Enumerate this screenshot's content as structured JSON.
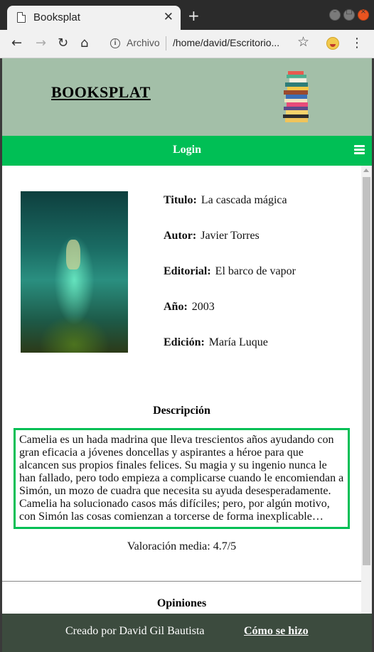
{
  "browser": {
    "tab_title": "Booksplat",
    "tab_close": "✕",
    "new_tab": "+",
    "url_secure_label": "Archivo",
    "url": "/home/david/Escritorio..."
  },
  "header": {
    "site_title": "BOOKSPLAT"
  },
  "navbar": {
    "login_label": "Login"
  },
  "book": {
    "fields": [
      {
        "label": "Titulo:",
        "value": "La cascada mágica"
      },
      {
        "label": "Autor:",
        "value": "Javier Torres"
      },
      {
        "label": "Editorial:",
        "value": "El barco de vapor"
      },
      {
        "label": "Año:",
        "value": "2003"
      },
      {
        "label": "Edición:",
        "value": "María Luque"
      }
    ],
    "description_title": "Descripción",
    "description": "Camelia es un hada madrina que lleva trescientos años ayudando con gran eficacia a jóvenes doncellas y aspirantes a héroe para que alcancen sus propios finales felices. Su magia y su ingenio nunca le han fallado, pero todo empieza a complicarse cuando le encomiendan a Simón, un mozo de cuadra que necesita su ayuda desesperadamente. Camelia ha solucionado casos más difíciles; pero, por algún motivo, con Simón las cosas comienzan a torcerse de forma inexplicable…",
    "rating": "Valoración media: 4.7/5",
    "opinions_title": "Opiniones"
  },
  "footer": {
    "credit": "Creado por David Gil Bautista",
    "link": "Cómo se hizo"
  },
  "colors": {
    "header_bg": "#a3bfa8",
    "accent_green": "#00bf55",
    "footer_bg": "#3c4b3e"
  }
}
